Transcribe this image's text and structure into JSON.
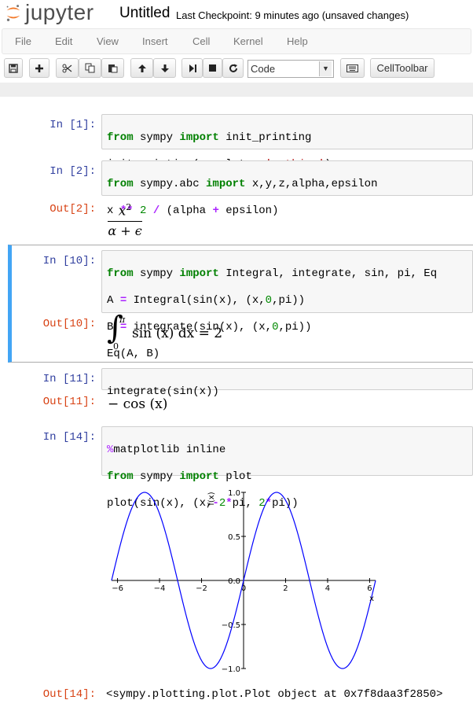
{
  "header": {
    "logo_text": "jupyter",
    "notebook_title": "Untitled",
    "checkpoint": "Last Checkpoint: 9 minutes ago (unsaved changes)"
  },
  "menu": [
    "File",
    "Edit",
    "View",
    "Insert",
    "Cell",
    "Kernel",
    "Help"
  ],
  "toolbar": {
    "buttons": [
      "save",
      "add-cell",
      "cut",
      "copy",
      "paste",
      "move-up",
      "move-down",
      "run",
      "stop",
      "restart"
    ],
    "cell_type": "Code",
    "celltoolbar_label": "CellToolbar"
  },
  "cells": {
    "c1": {
      "in_prompt": "In [1]:"
    },
    "c2": {
      "in_prompt": "In [2]:",
      "out_prompt": "Out[2]:"
    },
    "c3": {
      "in_prompt": "In [10]:",
      "out_prompt": "Out[10]:"
    },
    "c4": {
      "in_prompt": "In [11]:",
      "out_prompt": "Out[11]:"
    },
    "c5": {
      "in_prompt": "In [14]:",
      "out_prompt": "Out[14]:",
      "out_text": "<sympy.plotting.plot.Plot object at 0x7f8daa3f2850>"
    }
  },
  "code": {
    "c1": [
      "from sympy import init_printing",
      "init_printing(use_latex='mathjax')"
    ],
    "c2": [
      "from sympy.abc import x,y,z,alpha,epsilon",
      "x ** 2 / (alpha + epsilon)"
    ],
    "c3": [
      "from sympy import Integral, integrate, sin, pi, Eq",
      "A = Integral(sin(x), (x,0,pi))",
      "B = integrate(sin(x), (x,0,pi))",
      "Eq(A, B)"
    ],
    "c4": [
      "integrate(sin(x))"
    ],
    "c5": [
      "%matplotlib inline",
      "from sympy import plot",
      "plot(sin(x), (x,-2*pi, 2*pi))"
    ]
  },
  "outputs": {
    "out2": {
      "numerator": "x",
      "numerator_exp": "2",
      "denominator": "α + ϵ"
    },
    "out10": {
      "integral": "∫",
      "upper": "π",
      "lower": "0",
      "body": "sin (x) dx = 2"
    },
    "out11": {
      "expr": "− cos (x)"
    }
  },
  "chart_data": {
    "type": "line",
    "function": "sin(x)",
    "xlabel": "x",
    "ylabel": "f(x)",
    "xlim": [
      -6.283,
      6.283
    ],
    "ylim": [
      -1.0,
      1.0
    ],
    "x_ticks": [
      "−6",
      "−4",
      "−2",
      "0",
      "2",
      "4",
      "6"
    ],
    "y_ticks": [
      "1.0",
      "0.5",
      "0.0",
      "−0.5",
      "−1.0"
    ],
    "line_color": "#0000ff",
    "grid": false
  },
  "colors": {
    "accent": "#42a5f5",
    "in_prompt": "#303f9f",
    "out_prompt": "#d84315",
    "logo_orange": "#f37726"
  }
}
